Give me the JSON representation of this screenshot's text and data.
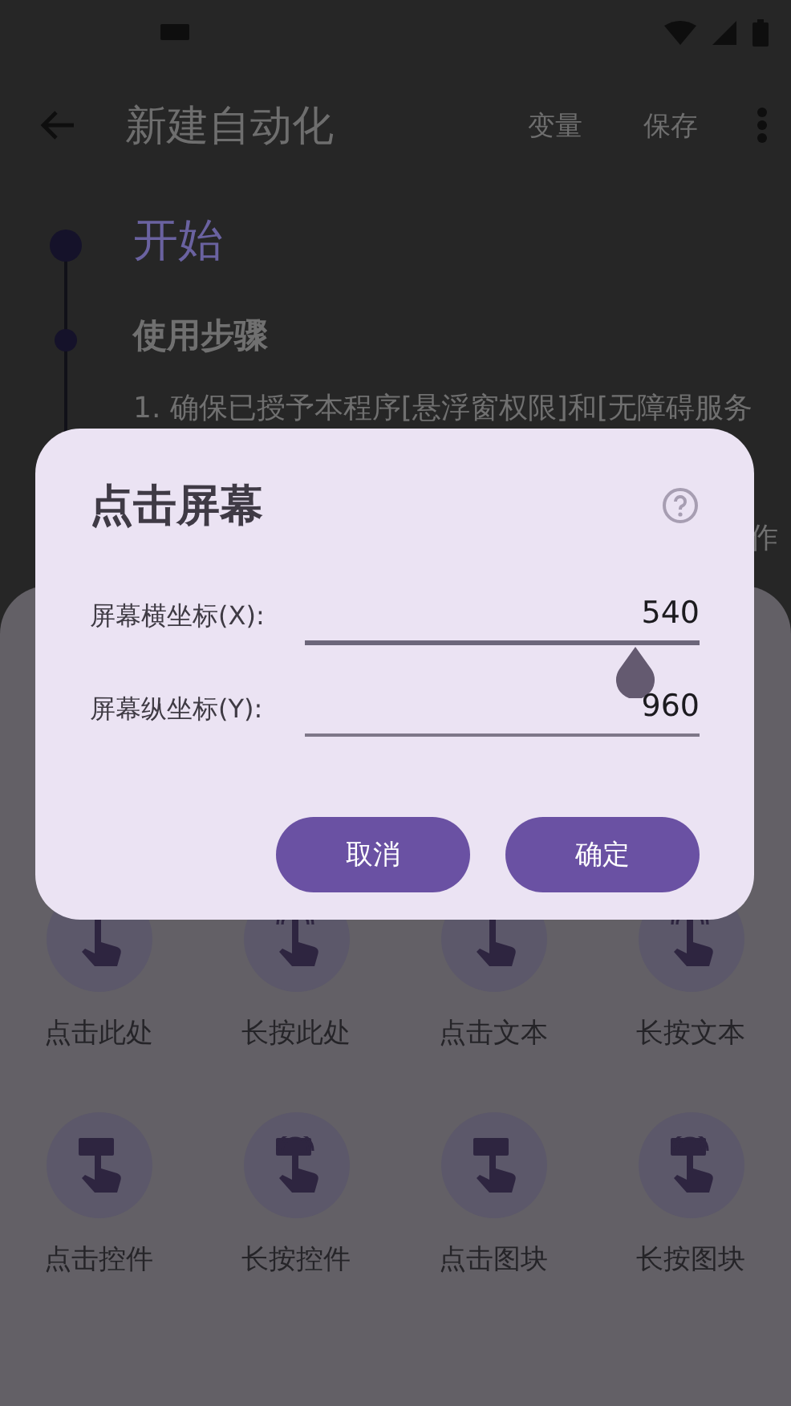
{
  "app_bar": {
    "title": "新建自动化",
    "actions": [
      "变量",
      "保存"
    ]
  },
  "timeline": [
    {
      "kind": "start",
      "title": "开始"
    },
    {
      "kind": "section",
      "title": "使用步骤",
      "lines": [
        "1. 确保已授予本程序[悬浮窗权限]和[无障碍服务",
        "作"
      ]
    }
  ],
  "actions": [
    {
      "kind": "tap",
      "label": "点击此处"
    },
    {
      "kind": "hold",
      "label": "长按此处"
    },
    {
      "kind": "tap",
      "label": "点击文本"
    },
    {
      "kind": "hold",
      "label": "长按文本"
    },
    {
      "kind": "tap-box",
      "label": "点击控件"
    },
    {
      "kind": "hold-box",
      "label": "长按控件"
    },
    {
      "kind": "tap-box",
      "label": "点击图块"
    },
    {
      "kind": "hold-box",
      "label": "长按图块"
    }
  ],
  "dialog": {
    "title": "点击屏幕",
    "fields": [
      {
        "label": "屏幕横坐标(X):",
        "value": "540",
        "focused": true
      },
      {
        "label": "屏幕纵坐标(Y):",
        "value": "960",
        "focused": false
      }
    ],
    "buttons": [
      "取消",
      "确定"
    ]
  }
}
